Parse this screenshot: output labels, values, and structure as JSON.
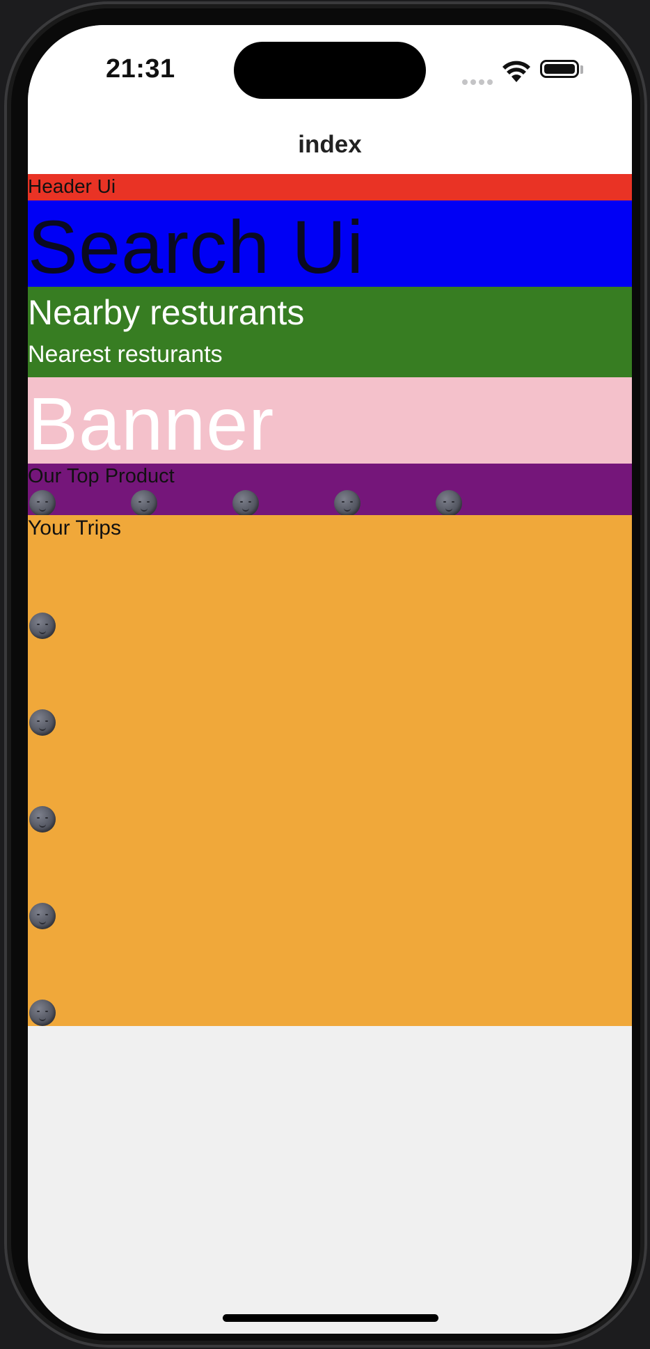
{
  "status_bar": {
    "time": "21:31",
    "icons": [
      "cellular-signal-icon",
      "wifi-icon",
      "battery-icon"
    ]
  },
  "nav": {
    "title": "index"
  },
  "sections": {
    "header": {
      "label": "Header Ui",
      "color": "#e93325"
    },
    "search": {
      "label": "Search Ui",
      "color": "#0000f5"
    },
    "nearby": {
      "title": "Nearby resturants",
      "subtitle": "Nearest resturants",
      "color": "#377d22"
    },
    "banner": {
      "label": "Banner",
      "color": "#f4c1cb"
    },
    "top_product": {
      "label": "Our Top Product",
      "color": "#75167a",
      "items": [
        "moon-face-icon",
        "moon-face-icon",
        "moon-face-icon",
        "moon-face-icon",
        "moon-face-icon"
      ]
    },
    "trips": {
      "label": "Your Trips",
      "color": "#f0a83a",
      "items": [
        "moon-face-icon",
        "moon-face-icon",
        "moon-face-icon",
        "moon-face-icon",
        "moon-face-icon"
      ]
    }
  }
}
